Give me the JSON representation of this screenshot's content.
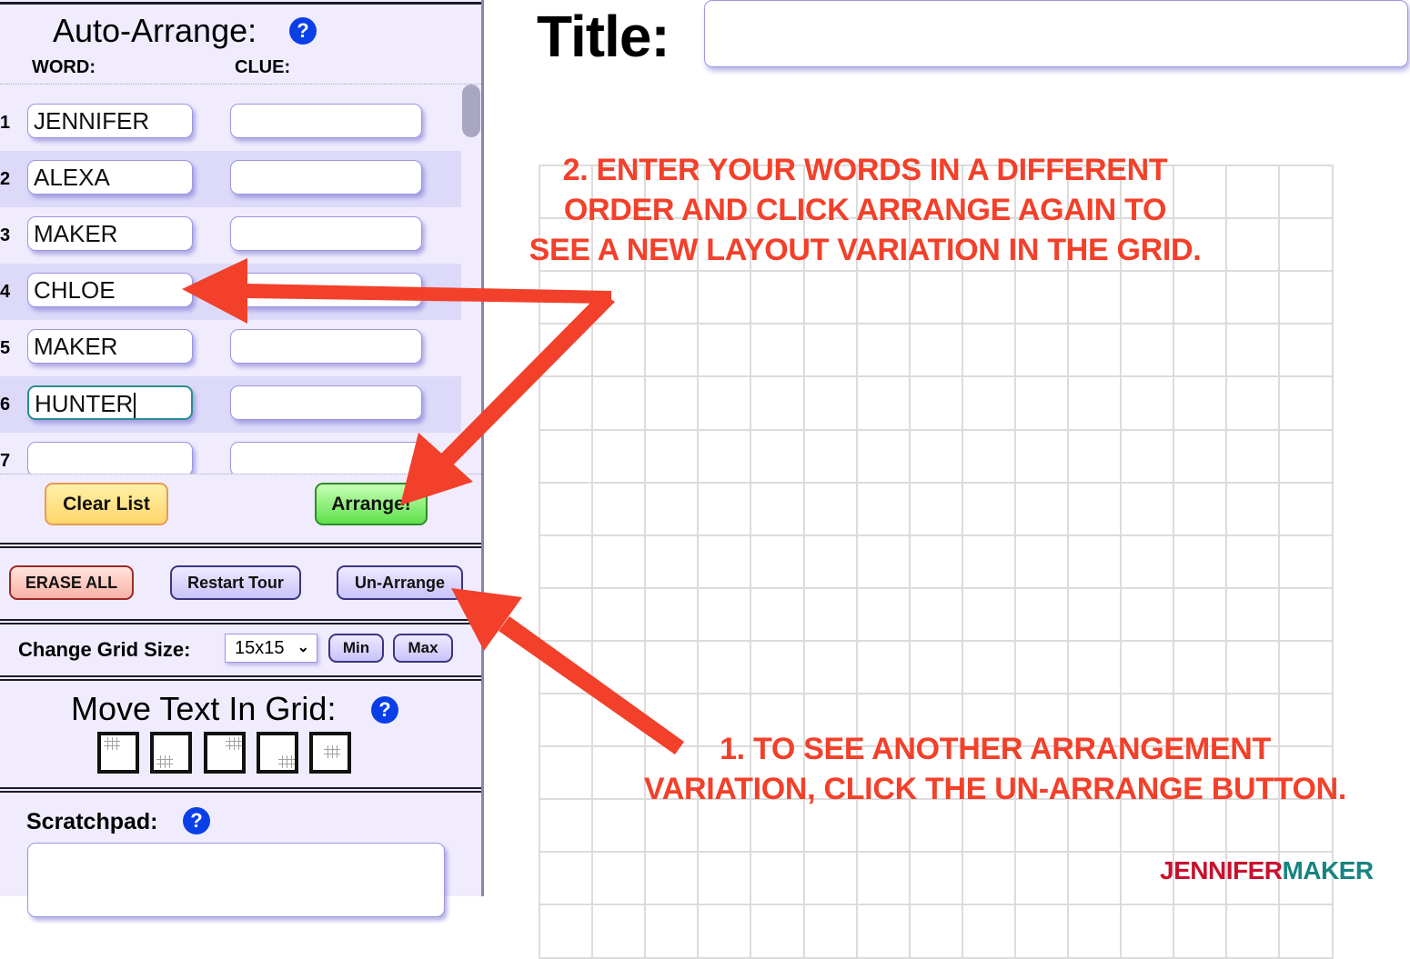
{
  "auto_arrange": {
    "title": "Auto-Arrange:",
    "help_icon": "?",
    "word_header": "WORD:",
    "clue_header": "CLUE:",
    "rows": [
      {
        "num": "1",
        "word": "JENNIFER",
        "clue": ""
      },
      {
        "num": "2",
        "word": "ALEXA",
        "clue": ""
      },
      {
        "num": "3",
        "word": "MAKER",
        "clue": ""
      },
      {
        "num": "4",
        "word": "CHLOE",
        "clue": ""
      },
      {
        "num": "5",
        "word": "MAKER",
        "clue": ""
      },
      {
        "num": "6",
        "word": "HUNTER",
        "clue": ""
      },
      {
        "num": "7",
        "word": "",
        "clue": ""
      }
    ],
    "focused_row": 6,
    "clear_list_label": "Clear List",
    "arrange_label": "Arrange!"
  },
  "actions": {
    "erase_all_label": "ERASE ALL",
    "restart_tour_label": "Restart Tour",
    "unarrange_label": "Un-Arrange"
  },
  "grid_size": {
    "label": "Change Grid Size:",
    "selected": "15x15",
    "min_label": "Min",
    "max_label": "Max"
  },
  "move_text": {
    "title": "Move Text In Grid:",
    "help_icon": "?",
    "options": [
      "top-left",
      "bottom-left",
      "top-right",
      "bottom-right",
      "center"
    ]
  },
  "scratchpad": {
    "label": "Scratchpad:",
    "help_icon": "?",
    "value": ""
  },
  "title_field": {
    "label": "Title:",
    "value": ""
  },
  "grid": {
    "rows": 15,
    "cols": 15
  },
  "annotations": {
    "step2": [
      "2. ENTER YOUR WORDS IN A DIFFERENT",
      "ORDER AND CLICK ARRANGE AGAIN TO",
      "SEE A NEW LAYOUT VARIATION IN THE GRID."
    ],
    "step1": [
      "1. TO SEE ANOTHER ARRANGEMENT",
      "VARIATION, CLICK THE UN-ARRANGE BUTTON."
    ],
    "color": "#f2402a"
  },
  "logo": {
    "part1": "JENNIFER",
    "part2": "MAKER",
    "color1": "#c8102e",
    "color2": "#16847f"
  }
}
